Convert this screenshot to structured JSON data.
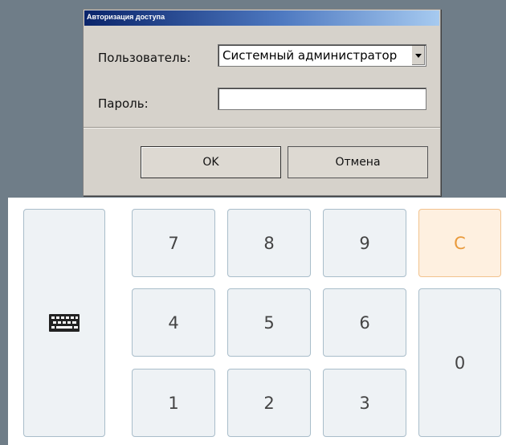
{
  "dialog": {
    "title": "Авторизация доступа",
    "user_label": "Пользователь:",
    "user_value": "Системный администратор",
    "password_label": "Пароль:",
    "password_value": "",
    "ok_label": "OK",
    "cancel_label": "Отмена"
  },
  "keypad": {
    "keys": {
      "k7": "7",
      "k8": "8",
      "k9": "9",
      "k4": "4",
      "k5": "5",
      "k6": "6",
      "k1": "1",
      "k2": "2",
      "k3": "3",
      "clear": "C",
      "zero": "0"
    },
    "keyboard_icon": "keyboard-icon"
  },
  "colors": {
    "desktop": "#6f7d88",
    "dialog_bg": "#d6d2cb",
    "titlebar_start": "#0a246a",
    "titlebar_end": "#a6caf0",
    "key_bg": "#eef2f5",
    "key_border": "#a9bdca",
    "clear_bg": "#fef0e0",
    "clear_text": "#e99a3c"
  }
}
